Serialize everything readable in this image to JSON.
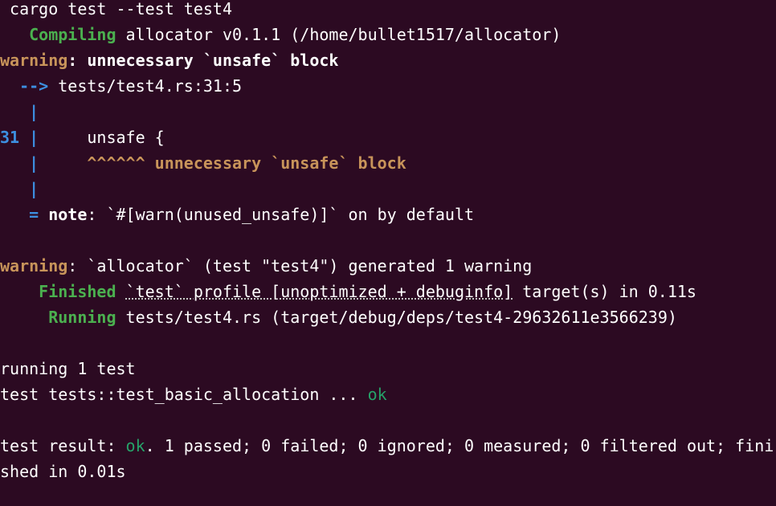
{
  "terminal": {
    "lines": {
      "l1": " cargo test --test test4",
      "l2_indent": "   ",
      "l2_status": "Compiling",
      "l2_rest": " allocator v0.1.1 (/home/bullet1517/allocator)",
      "l3_warning": "warning",
      "l3_rest": ": unnecessary `unsafe` block",
      "l4_arrow": "  -->",
      "l4_rest": " tests/test4.rs:31:5",
      "l5_bar": "   |",
      "l6_num": "31 |",
      "l6_code": "     unsafe {",
      "l7_bar": "   |",
      "l7_carets": "     ^^^^^^ unnecessary `unsafe` block",
      "l8_bar": "   |",
      "l9_eq": "   =",
      "l9_note": " note",
      "l9_rest": ": `#[warn(unused_unsafe)]` on by default",
      "l11_warning": "warning",
      "l11_rest": ": `allocator` (test \"test4\") generated 1 warning",
      "l12_indent": "    ",
      "l12_status": "Finished",
      "l12_space": " ",
      "l12_dotted": "`test` profile [unoptimized + debuginfo]",
      "l12_rest": " target(s) in 0.11s",
      "l13_indent": "     ",
      "l13_status": "Running",
      "l13_rest": " tests/test4.rs (target/debug/deps/test4-29632611e3566239)",
      "l15": "running 1 test",
      "l16_rest": "test tests::test_basic_allocation ... ",
      "l16_ok": "ok",
      "l18_prefix": "test result: ",
      "l18_ok": "ok",
      "l18_rest": ". 1 passed; 0 failed; 0 ignored; 0 measured; 0 filtered out; fini",
      "l19": "shed in 0.01s"
    }
  }
}
